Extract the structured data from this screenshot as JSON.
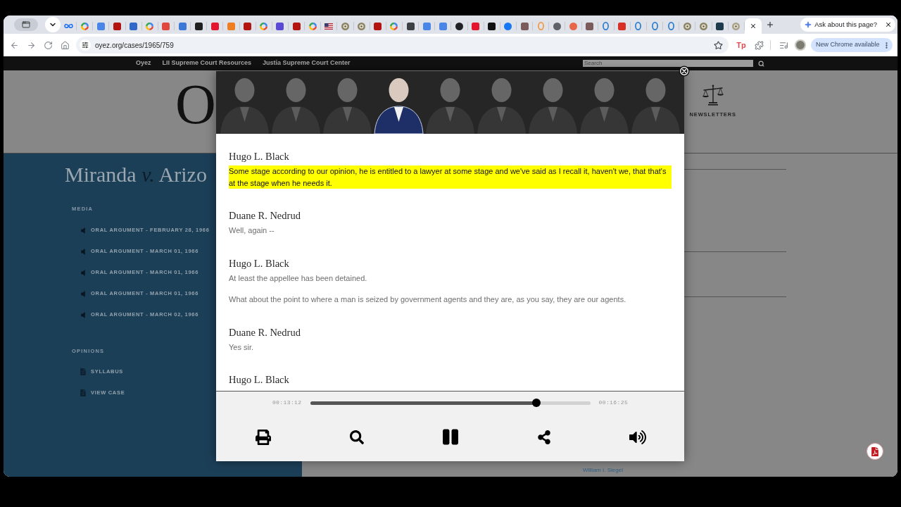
{
  "browser": {
    "tabs": [
      {
        "kind": "infinity",
        "color": "#1d6ff2",
        "selected": false
      },
      {
        "kind": "multi",
        "selected": false
      },
      {
        "kind": "tile",
        "color": "#4a86e8",
        "selected": false
      },
      {
        "kind": "tile",
        "color": "#b3140f",
        "selected": false
      },
      {
        "kind": "tile",
        "color": "#2f68c9",
        "selected": false
      },
      {
        "kind": "multi",
        "selected": false
      },
      {
        "kind": "tile",
        "color": "#e0483e",
        "selected": false
      },
      {
        "kind": "tile",
        "color": "#3b78d8",
        "selected": false
      },
      {
        "kind": "tile",
        "color": "#1f1f1f",
        "selected": false
      },
      {
        "kind": "tile",
        "color": "#e4162f",
        "selected": false
      },
      {
        "kind": "tile",
        "color": "#ef7d22",
        "selected": false
      },
      {
        "kind": "tile",
        "color": "#b3140f",
        "selected": false
      },
      {
        "kind": "multi",
        "selected": false
      },
      {
        "kind": "tile",
        "color": "#5a49d6",
        "selected": false
      },
      {
        "kind": "tile",
        "color": "#b3140f",
        "selected": false
      },
      {
        "kind": "multi",
        "selected": false
      },
      {
        "kind": "flag",
        "selected": false
      },
      {
        "kind": "seal",
        "color": "#8c8466",
        "selected": false
      },
      {
        "kind": "seal",
        "color": "#8c8466",
        "selected": false
      },
      {
        "kind": "tile",
        "color": "#b3140f",
        "selected": false
      },
      {
        "kind": "multi",
        "selected": false
      },
      {
        "kind": "tile",
        "color": "#3c4043",
        "selected": false
      },
      {
        "kind": "tile",
        "color": "#4a86e8",
        "selected": false
      },
      {
        "kind": "tile",
        "color": "#4a86e8",
        "selected": false
      },
      {
        "kind": "disc",
        "color": "#202124",
        "selected": false
      },
      {
        "kind": "tile",
        "color": "#e4162f",
        "selected": false
      },
      {
        "kind": "tile",
        "color": "#111111",
        "selected": false
      },
      {
        "kind": "disc",
        "color": "#1877f2",
        "selected": false
      },
      {
        "kind": "tile",
        "color": "#7a5a5a",
        "selected": false
      },
      {
        "kind": "ring",
        "color": "#f2994a",
        "selected": false
      },
      {
        "kind": "disc",
        "color": "#5f6368",
        "selected": false
      },
      {
        "kind": "disc",
        "color": "#e8664a",
        "selected": false
      },
      {
        "kind": "tile",
        "color": "#7a5a5a",
        "selected": false
      },
      {
        "kind": "ring",
        "color": "#2f80d1",
        "selected": false
      },
      {
        "kind": "tile",
        "color": "#d93025",
        "selected": false
      },
      {
        "kind": "ring",
        "color": "#2f80d1",
        "selected": false
      },
      {
        "kind": "ring",
        "color": "#2f80d1",
        "selected": false
      },
      {
        "kind": "ring",
        "color": "#2f80d1",
        "selected": false
      },
      {
        "kind": "seal",
        "color": "#8c8466",
        "selected": false
      },
      {
        "kind": "seal",
        "color": "#8c8466",
        "selected": false
      },
      {
        "kind": "tile",
        "color": "#1e3a4d",
        "selected": false
      },
      {
        "kind": "seal",
        "color": "#a8a38a",
        "selected": false
      },
      {
        "selected": true
      }
    ],
    "ask_chip": {
      "label": "Ask about this page?"
    },
    "address_bar": {
      "url": "oyez.org/cases/1965/759"
    },
    "extension_label": "Tp",
    "update_chip": {
      "label": "New Chrome available"
    }
  },
  "site_nav": {
    "links": [
      "Oyez",
      "LII Supreme Court Resources",
      "Justia Supreme Court Center"
    ],
    "search": {
      "placeholder": "Search"
    }
  },
  "page_header": {
    "logo": "O",
    "newsletters": "NEWSLETTERS"
  },
  "case_sidebar": {
    "title": "Miranda *v.* Arizo",
    "sections": [
      {
        "heading": "MEDIA",
        "items": [
          {
            "kind": "audio",
            "label": "ORAL ARGUMENT - FEBRUARY 28, 1966"
          },
          {
            "kind": "audio",
            "label": "ORAL ARGUMENT - MARCH 01, 1966"
          },
          {
            "kind": "audio",
            "label": "ORAL ARGUMENT - MARCH 01, 1966"
          },
          {
            "kind": "audio",
            "label": "ORAL ARGUMENT - MARCH 01, 1966"
          },
          {
            "kind": "audio",
            "label": "ORAL ARGUMENT - MARCH 02, 1966"
          }
        ]
      },
      {
        "heading": "OPINIONS",
        "items": [
          {
            "kind": "document",
            "label": "SYLLABUS"
          },
          {
            "kind": "document",
            "label": "VIEW CASE"
          }
        ]
      }
    ]
  },
  "case_content": {
    "author_link": "William I. Siegel"
  },
  "audio_player": {
    "portraits": [
      {
        "selected": false
      },
      {
        "selected": false
      },
      {
        "selected": false
      },
      {
        "selected": true
      },
      {
        "selected": false
      },
      {
        "selected": false
      },
      {
        "selected": false
      },
      {
        "selected": false
      },
      {
        "selected": false
      }
    ],
    "transcript": [
      {
        "speaker": "Hugo L. Black",
        "paragraphs": [
          {
            "text": "Some stage according to our opinion, he is entitled to a lawyer at some stage and we've said as I recall it, haven't we, that that's at the stage when he needs it.",
            "highlighted": true
          }
        ]
      },
      {
        "speaker": "Duane R. Nedrud",
        "paragraphs": [
          {
            "text": "Well, again --",
            "highlighted": false
          }
        ]
      },
      {
        "speaker": "Hugo L. Black",
        "paragraphs": [
          {
            "text": "At least the appellee has been detained.",
            "highlighted": false
          },
          {
            "text": "What about the point to where a man is seized by government agents and they are, as you say, they are our agents.",
            "highlighted": false
          }
        ]
      },
      {
        "speaker": "Duane R. Nedrud",
        "paragraphs": [
          {
            "text": "Yes sir.",
            "highlighted": false
          }
        ]
      },
      {
        "speaker": "Hugo L. Black"
      }
    ],
    "elapsed": "00:13:12",
    "level": 0.807,
    "duration": "00:16:25",
    "playing": true
  }
}
